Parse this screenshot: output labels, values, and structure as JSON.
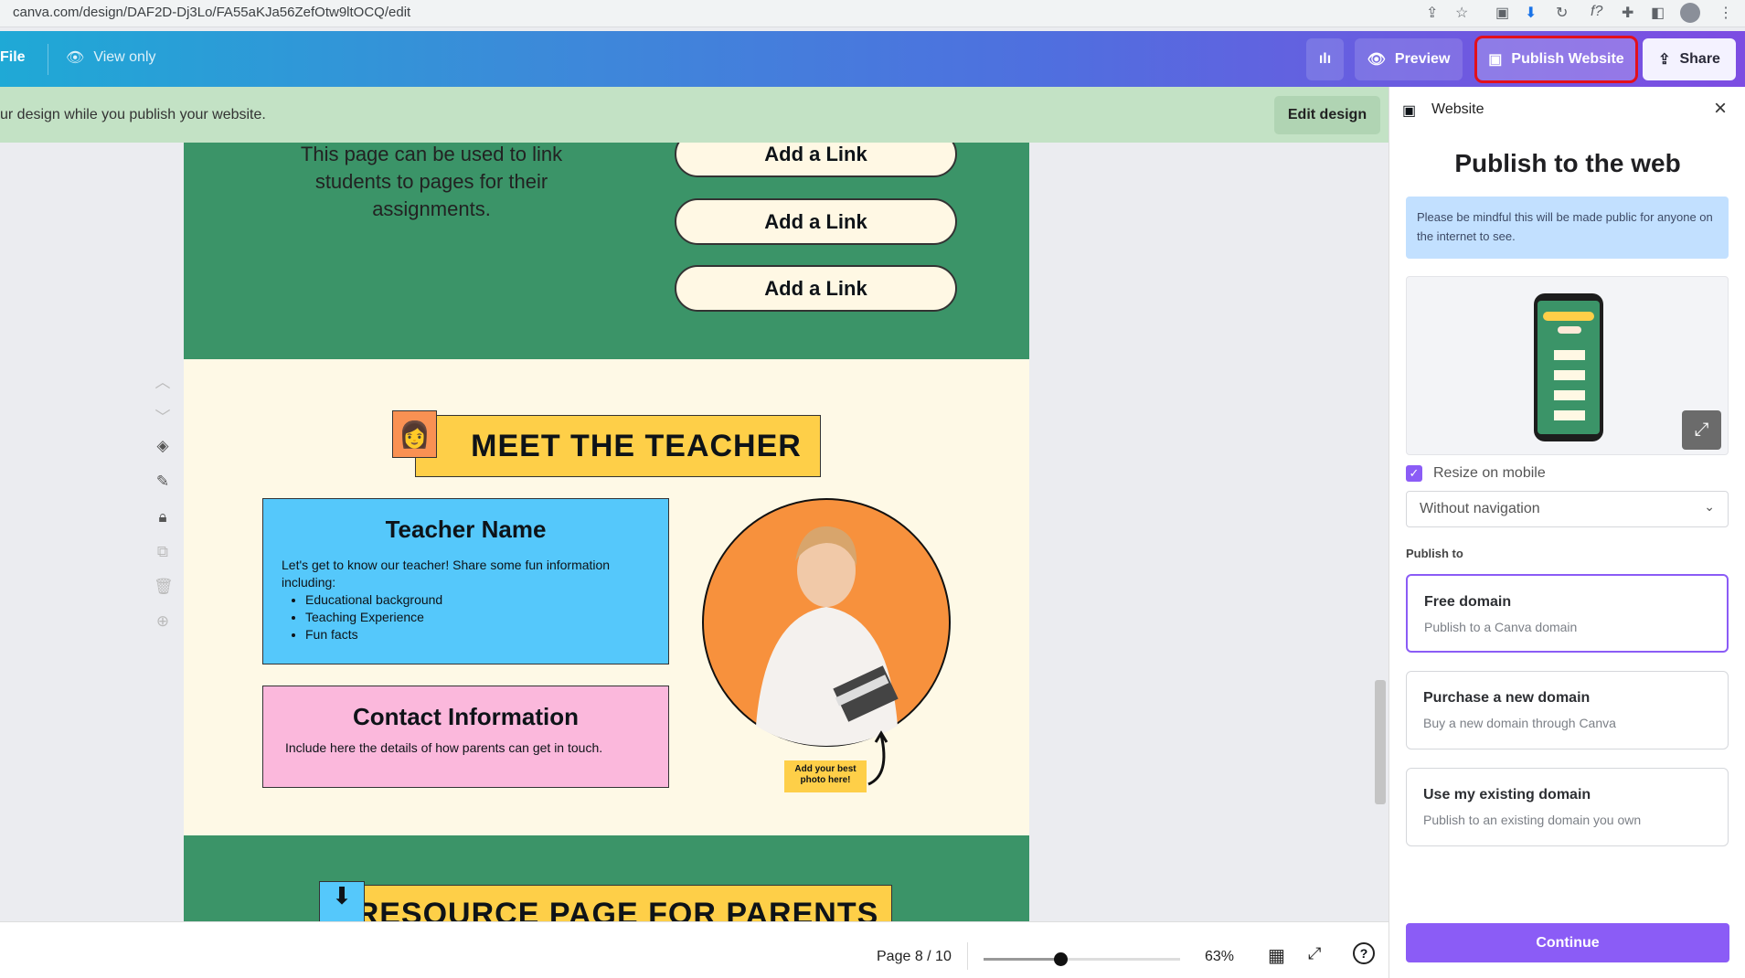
{
  "browser": {
    "url": "canva.com/design/DAF2D-Dj3Lo/FA55aKJa56ZefOtw9ltOCQ/edit"
  },
  "toolbar": {
    "file": "File",
    "view_only": "View only",
    "preview": "Preview",
    "publish_website": "Publish Website",
    "share": "Share"
  },
  "banner": {
    "message": "ur design while you publish your website.",
    "edit_design": "Edit design"
  },
  "design": {
    "intro_text": "This page can be used to link students to pages for their assignments.",
    "links": [
      "Add a Link",
      "Add a Link",
      "Add a Link"
    ],
    "meet_title": "MEET THE TEACHER",
    "teacher_name": "Teacher Name",
    "teacher_intro": "Let's get to know our teacher! Share some fun information including:",
    "teacher_bullets": [
      "Educational background",
      "Teaching Experience",
      "Fun facts"
    ],
    "contact_title": "Contact Information",
    "contact_text": "Include here the details of how parents can get in touch.",
    "photo_note": "Add your best photo here!",
    "resource_title": "RESOURCE PAGE FOR PARENTS"
  },
  "bottom": {
    "page": "Page 8 / 10",
    "zoom": "63%",
    "zoom_percent": 63
  },
  "panel": {
    "header": "Website",
    "title": "Publish to the web",
    "notice": "Please be mindful this will be made public for anyone on the internet to see.",
    "resize_on_mobile": "Resize on mobile",
    "resize_checked": true,
    "navigation_select": "Without navigation",
    "publish_to": "Publish to",
    "options": [
      {
        "title": "Free domain",
        "subtitle": "Publish to a Canva domain",
        "selected": true
      },
      {
        "title": "Purchase a new domain",
        "subtitle": "Buy a new domain through Canva",
        "selected": false
      },
      {
        "title": "Use my existing domain",
        "subtitle": "Publish to an existing domain you own",
        "selected": false
      }
    ],
    "continue": "Continue"
  },
  "colors": {
    "accent": "#8b3dff",
    "publish_highlight": "#e3101c",
    "page_green": "#3b9468",
    "page_cream": "#fef9e6",
    "teacher_box": "#55c8fb",
    "contact_box": "#fbb8dc",
    "banner_yellow": "#fecf48"
  }
}
